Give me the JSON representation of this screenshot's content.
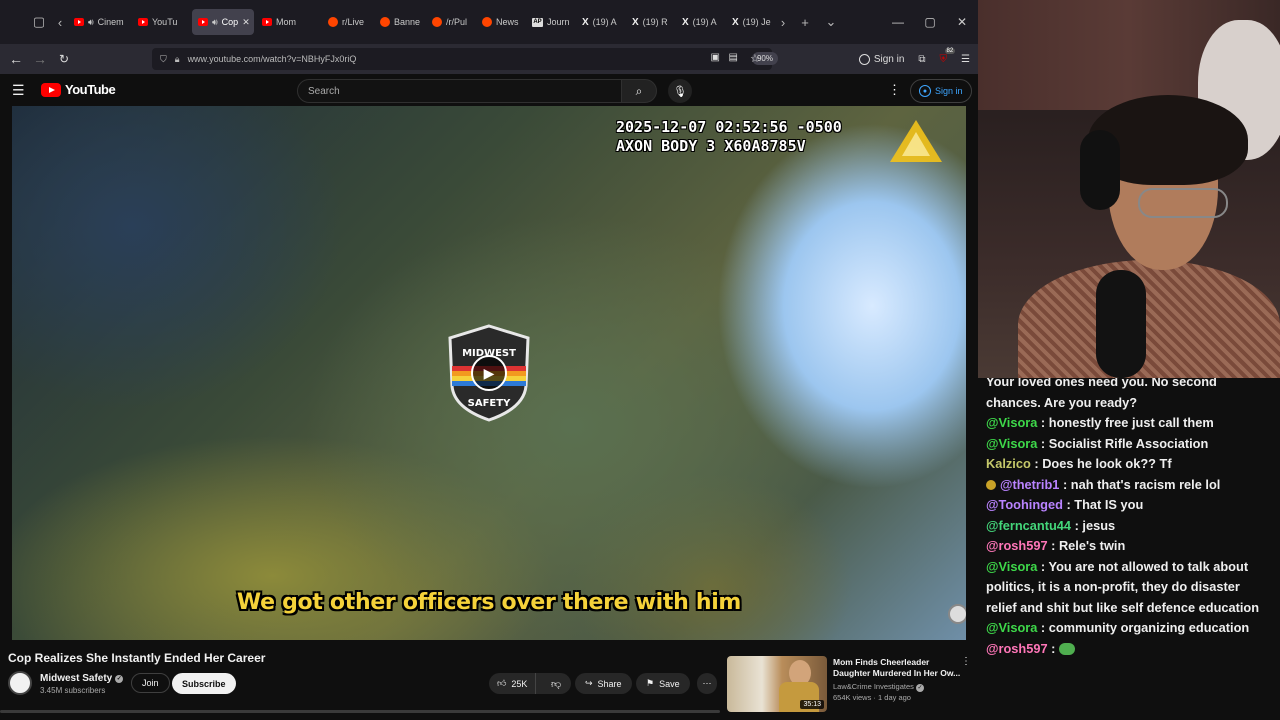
{
  "browser": {
    "tabs": [
      {
        "label": "Cinem",
        "icon": "youtube-icon",
        "audio": true
      },
      {
        "label": "YouTu",
        "icon": "youtube-icon"
      },
      {
        "label": "Cop",
        "icon": "youtube-icon",
        "audio": true,
        "active": true
      },
      {
        "label": "Mom",
        "icon": "youtube-icon"
      },
      {
        "label": "r/Live",
        "icon": "reddit-icon"
      },
      {
        "label": "Banne",
        "icon": "reddit-icon"
      },
      {
        "label": "/r/Pul",
        "icon": "reddit-icon"
      },
      {
        "label": "News",
        "icon": "reddit-icon"
      },
      {
        "label": "Journ",
        "icon": "ap-icon"
      },
      {
        "label": "(19) A",
        "icon": "x-icon"
      },
      {
        "label": "(19) R",
        "icon": "x-icon"
      },
      {
        "label": "(19) A",
        "icon": "x-icon"
      },
      {
        "label": "(19) Je",
        "icon": "x-icon"
      }
    ],
    "url": "www.youtube.com/watch?v=NBHyFJx0riQ",
    "zoom": "90%",
    "sign_in": "Sign in",
    "extension_badge": "82"
  },
  "youtube": {
    "logo_text": "YouTube",
    "search_placeholder": "Search",
    "sign_in": "Sign in"
  },
  "video": {
    "overlay_timestamp": "2025-12-07 02:52:56 -0500",
    "overlay_device": "AXON BODY 3 X60A8785V",
    "badge_top": "MIDWEST",
    "badge_bottom": "SAFETY",
    "caption": "We got other officers over there with him",
    "title": "Cop Realizes She Instantly Ended Her Career"
  },
  "channel": {
    "name": "Midwest Safety",
    "subscribers": "3.45M subscribers",
    "join_label": "Join",
    "subscribe_label": "Subscribe"
  },
  "actions": {
    "likes": "25K",
    "share": "Share",
    "save": "Save"
  },
  "recommendation": {
    "title": "Mom Finds Cheerleader Daughter Murdered In Her Ow...",
    "channel": "Law&Crime Investigates",
    "meta": "654K views · 1 day ago",
    "duration": "35:13"
  },
  "chat": {
    "partial_top": "Your loved ones need you. No second chances. Are you ready?",
    "messages": [
      {
        "author": "@Visora",
        "text": "honestly free just call them",
        "color": "#3ed84a"
      },
      {
        "author": "@Visora",
        "text": "Socialist Rifle Association",
        "color": "#3ed84a"
      },
      {
        "author": "Kalzico",
        "text": "Does he look ok?? Tf",
        "color": "#c5c86a"
      },
      {
        "author": "@thetrib1",
        "text": "nah that's racism rele lol",
        "color": "#b983ff",
        "badge": true
      },
      {
        "author": "@Toohinged",
        "text": "That IS you",
        "color": "#b983ff"
      },
      {
        "author": "@ferncantu44",
        "text": "jesus",
        "color": "#44d67a"
      },
      {
        "author": "@rosh597",
        "text": "Rele's twin",
        "color": "#ff76b8"
      },
      {
        "author": "@Visora",
        "text": "You are not allowed to talk about politics, it is a non-profit, they do disaster relief and shit but like self defence education",
        "color": "#3ed84a"
      },
      {
        "author": "@Visora",
        "text": "community organizing education",
        "color": "#3ed84a"
      },
      {
        "author": "@rosh597",
        "text": "",
        "color": "#ff76b8",
        "emote": true
      }
    ]
  }
}
